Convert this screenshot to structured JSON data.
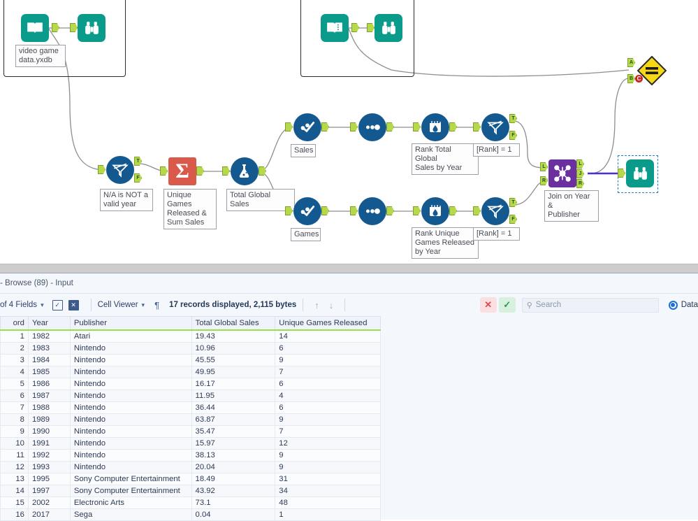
{
  "canvas": {
    "containers": [
      {
        "name": "input-container-left"
      },
      {
        "name": "input-container-right"
      }
    ],
    "tools": [
      {
        "id": "input1",
        "icon": "book-input-icon",
        "label": "video game\ndata.yxdb"
      },
      {
        "id": "browse1",
        "icon": "binoculars-browse-icon",
        "label": ""
      },
      {
        "id": "input2",
        "icon": "book-input-icon",
        "label": ""
      },
      {
        "id": "browse2",
        "icon": "binoculars-browse-icon",
        "label": ""
      },
      {
        "id": "filter1",
        "icon": "filter-icon",
        "label": "N/A is NOT a\nvalid year"
      },
      {
        "id": "summarize1",
        "icon": "summarize-sigma-icon",
        "label": "Unique Games\nReleased &\nSum Sales"
      },
      {
        "id": "formula1",
        "icon": "formula-flask-icon",
        "label": "Total Global Sales"
      },
      {
        "id": "select-top",
        "icon": "select-check-icon",
        "label": "Sales"
      },
      {
        "id": "sample-top",
        "icon": "sample-dots-icon",
        "label": ""
      },
      {
        "id": "multirow-top",
        "icon": "multi-row-formula-icon",
        "label": "Rank Total Global\nSales by Year"
      },
      {
        "id": "filter-top",
        "icon": "filter-icon",
        "label": "[Rank] = 1"
      },
      {
        "id": "select-bot",
        "icon": "select-check-icon",
        "label": "Games"
      },
      {
        "id": "sample-bot",
        "icon": "sample-dots-icon",
        "label": ""
      },
      {
        "id": "multirow-bot",
        "icon": "multi-row-formula-icon",
        "label": "Rank Unique\nGames Released\nby Year"
      },
      {
        "id": "filter-bot",
        "icon": "filter-icon",
        "label": "[Rank] = 1"
      },
      {
        "id": "join1",
        "icon": "join-icon",
        "label": "Join on Year &\nPublisher"
      },
      {
        "id": "browse-final",
        "icon": "binoculars-browse-icon",
        "label": ""
      },
      {
        "id": "compare1",
        "icon": "equals-diamond-icon",
        "label": ""
      }
    ],
    "anchor_labels": {
      "true": "T",
      "false": "F",
      "left": "L",
      "join": "J",
      "right": "R",
      "a": "A",
      "b": "B",
      "warn": "C"
    },
    "colors": {
      "tool_blue": "#13588f",
      "tool_teal": "#0b9b8a",
      "tool_purple": "#6b2fa0",
      "tool_orange": "#d9594a",
      "tool_yellow": "#f5d916",
      "anchor_green": "#b5d94b",
      "selection_blue": "#1b7fd4"
    }
  },
  "results": {
    "title": "- Browse (89) - Input",
    "toolbar": {
      "fields_label": "of 4 Fields",
      "select_all_icon": "checkbox-checked-icon",
      "deselect_icon": "boxed-x-icon",
      "viewer_label": "Cell Viewer",
      "pilcrow_icon": "pilcrow-icon",
      "record_info": "17 records displayed, 2,115 bytes",
      "nav_up_icon": "arrow-up-icon",
      "nav_down_icon": "arrow-down-icon",
      "cancel_label": "✕",
      "confirm_label": "✓",
      "search_placeholder": "Search",
      "search_icon": "search-icon",
      "data_radio_label": "Data"
    },
    "table": {
      "columns": [
        "ord",
        "Year",
        "Publisher",
        "Total Global Sales",
        "Unique Games Released"
      ],
      "rows": [
        [
          "1",
          "1982",
          "Atari",
          "19.43",
          "14"
        ],
        [
          "2",
          "1983",
          "Nintendo",
          "10.96",
          "6"
        ],
        [
          "3",
          "1984",
          "Nintendo",
          "45.55",
          "9"
        ],
        [
          "4",
          "1985",
          "Nintendo",
          "49.95",
          "7"
        ],
        [
          "5",
          "1986",
          "Nintendo",
          "16.17",
          "6"
        ],
        [
          "6",
          "1987",
          "Nintendo",
          "11.95",
          "4"
        ],
        [
          "7",
          "1988",
          "Nintendo",
          "36.44",
          "6"
        ],
        [
          "8",
          "1989",
          "Nintendo",
          "63.87",
          "9"
        ],
        [
          "9",
          "1990",
          "Nintendo",
          "35.47",
          "7"
        ],
        [
          "10",
          "1991",
          "Nintendo",
          "15.97",
          "12"
        ],
        [
          "11",
          "1992",
          "Nintendo",
          "38.13",
          "9"
        ],
        [
          "12",
          "1993",
          "Nintendo",
          "20.04",
          "9"
        ],
        [
          "13",
          "1995",
          "Sony Computer Entertainment",
          "18.49",
          "31"
        ],
        [
          "14",
          "1997",
          "Sony Computer Entertainment",
          "43.92",
          "34"
        ],
        [
          "15",
          "2002",
          "Electronic Arts",
          "73.1",
          "48"
        ],
        [
          "16",
          "2017",
          "Sega",
          "0.04",
          "1"
        ]
      ]
    }
  }
}
